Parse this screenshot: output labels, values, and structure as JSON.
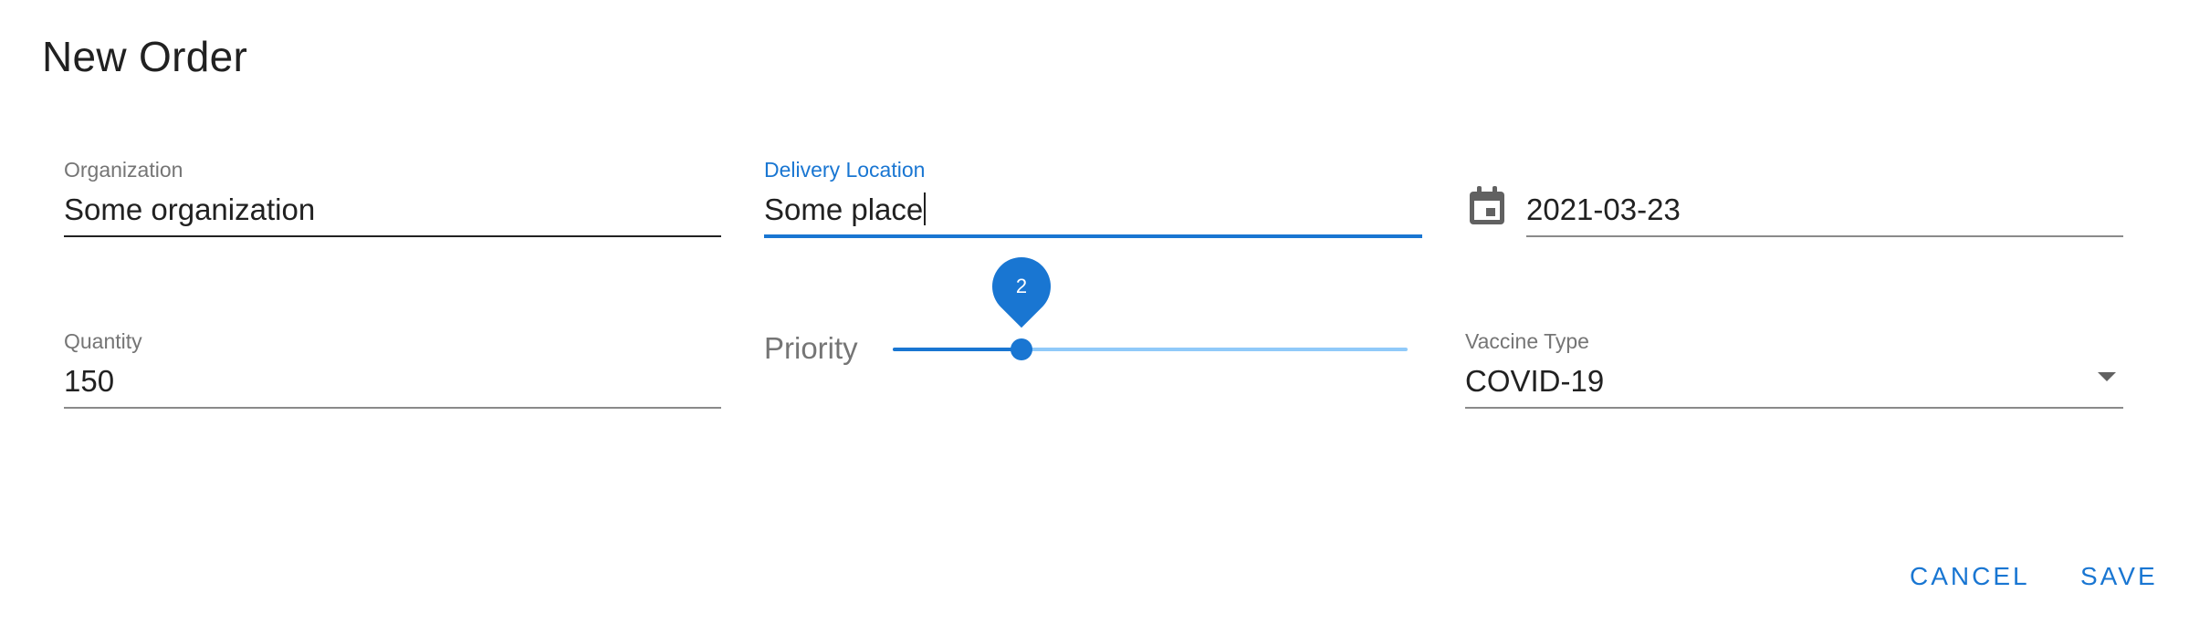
{
  "dialog": {
    "title": "New Order"
  },
  "fields": {
    "organization": {
      "label": "Organization",
      "value": "Some organization"
    },
    "delivery_location": {
      "label": "Delivery Location",
      "value": "Some place"
    },
    "date": {
      "value": "2021-03-23",
      "icon": "calendar-icon"
    },
    "quantity": {
      "label": "Quantity",
      "value": "150"
    },
    "priority": {
      "label": "Priority",
      "value": "2",
      "min": 1,
      "max": 5
    },
    "vaccine_type": {
      "label": "Vaccine Type",
      "value": "COVID-19",
      "icon": "dropdown-arrow-icon"
    }
  },
  "actions": {
    "cancel_label": "CANCEL",
    "save_label": "SAVE"
  },
  "colors": {
    "accent": "#1976d2",
    "accent_light": "#90caf9",
    "text": "#212121",
    "label": "#757575"
  }
}
